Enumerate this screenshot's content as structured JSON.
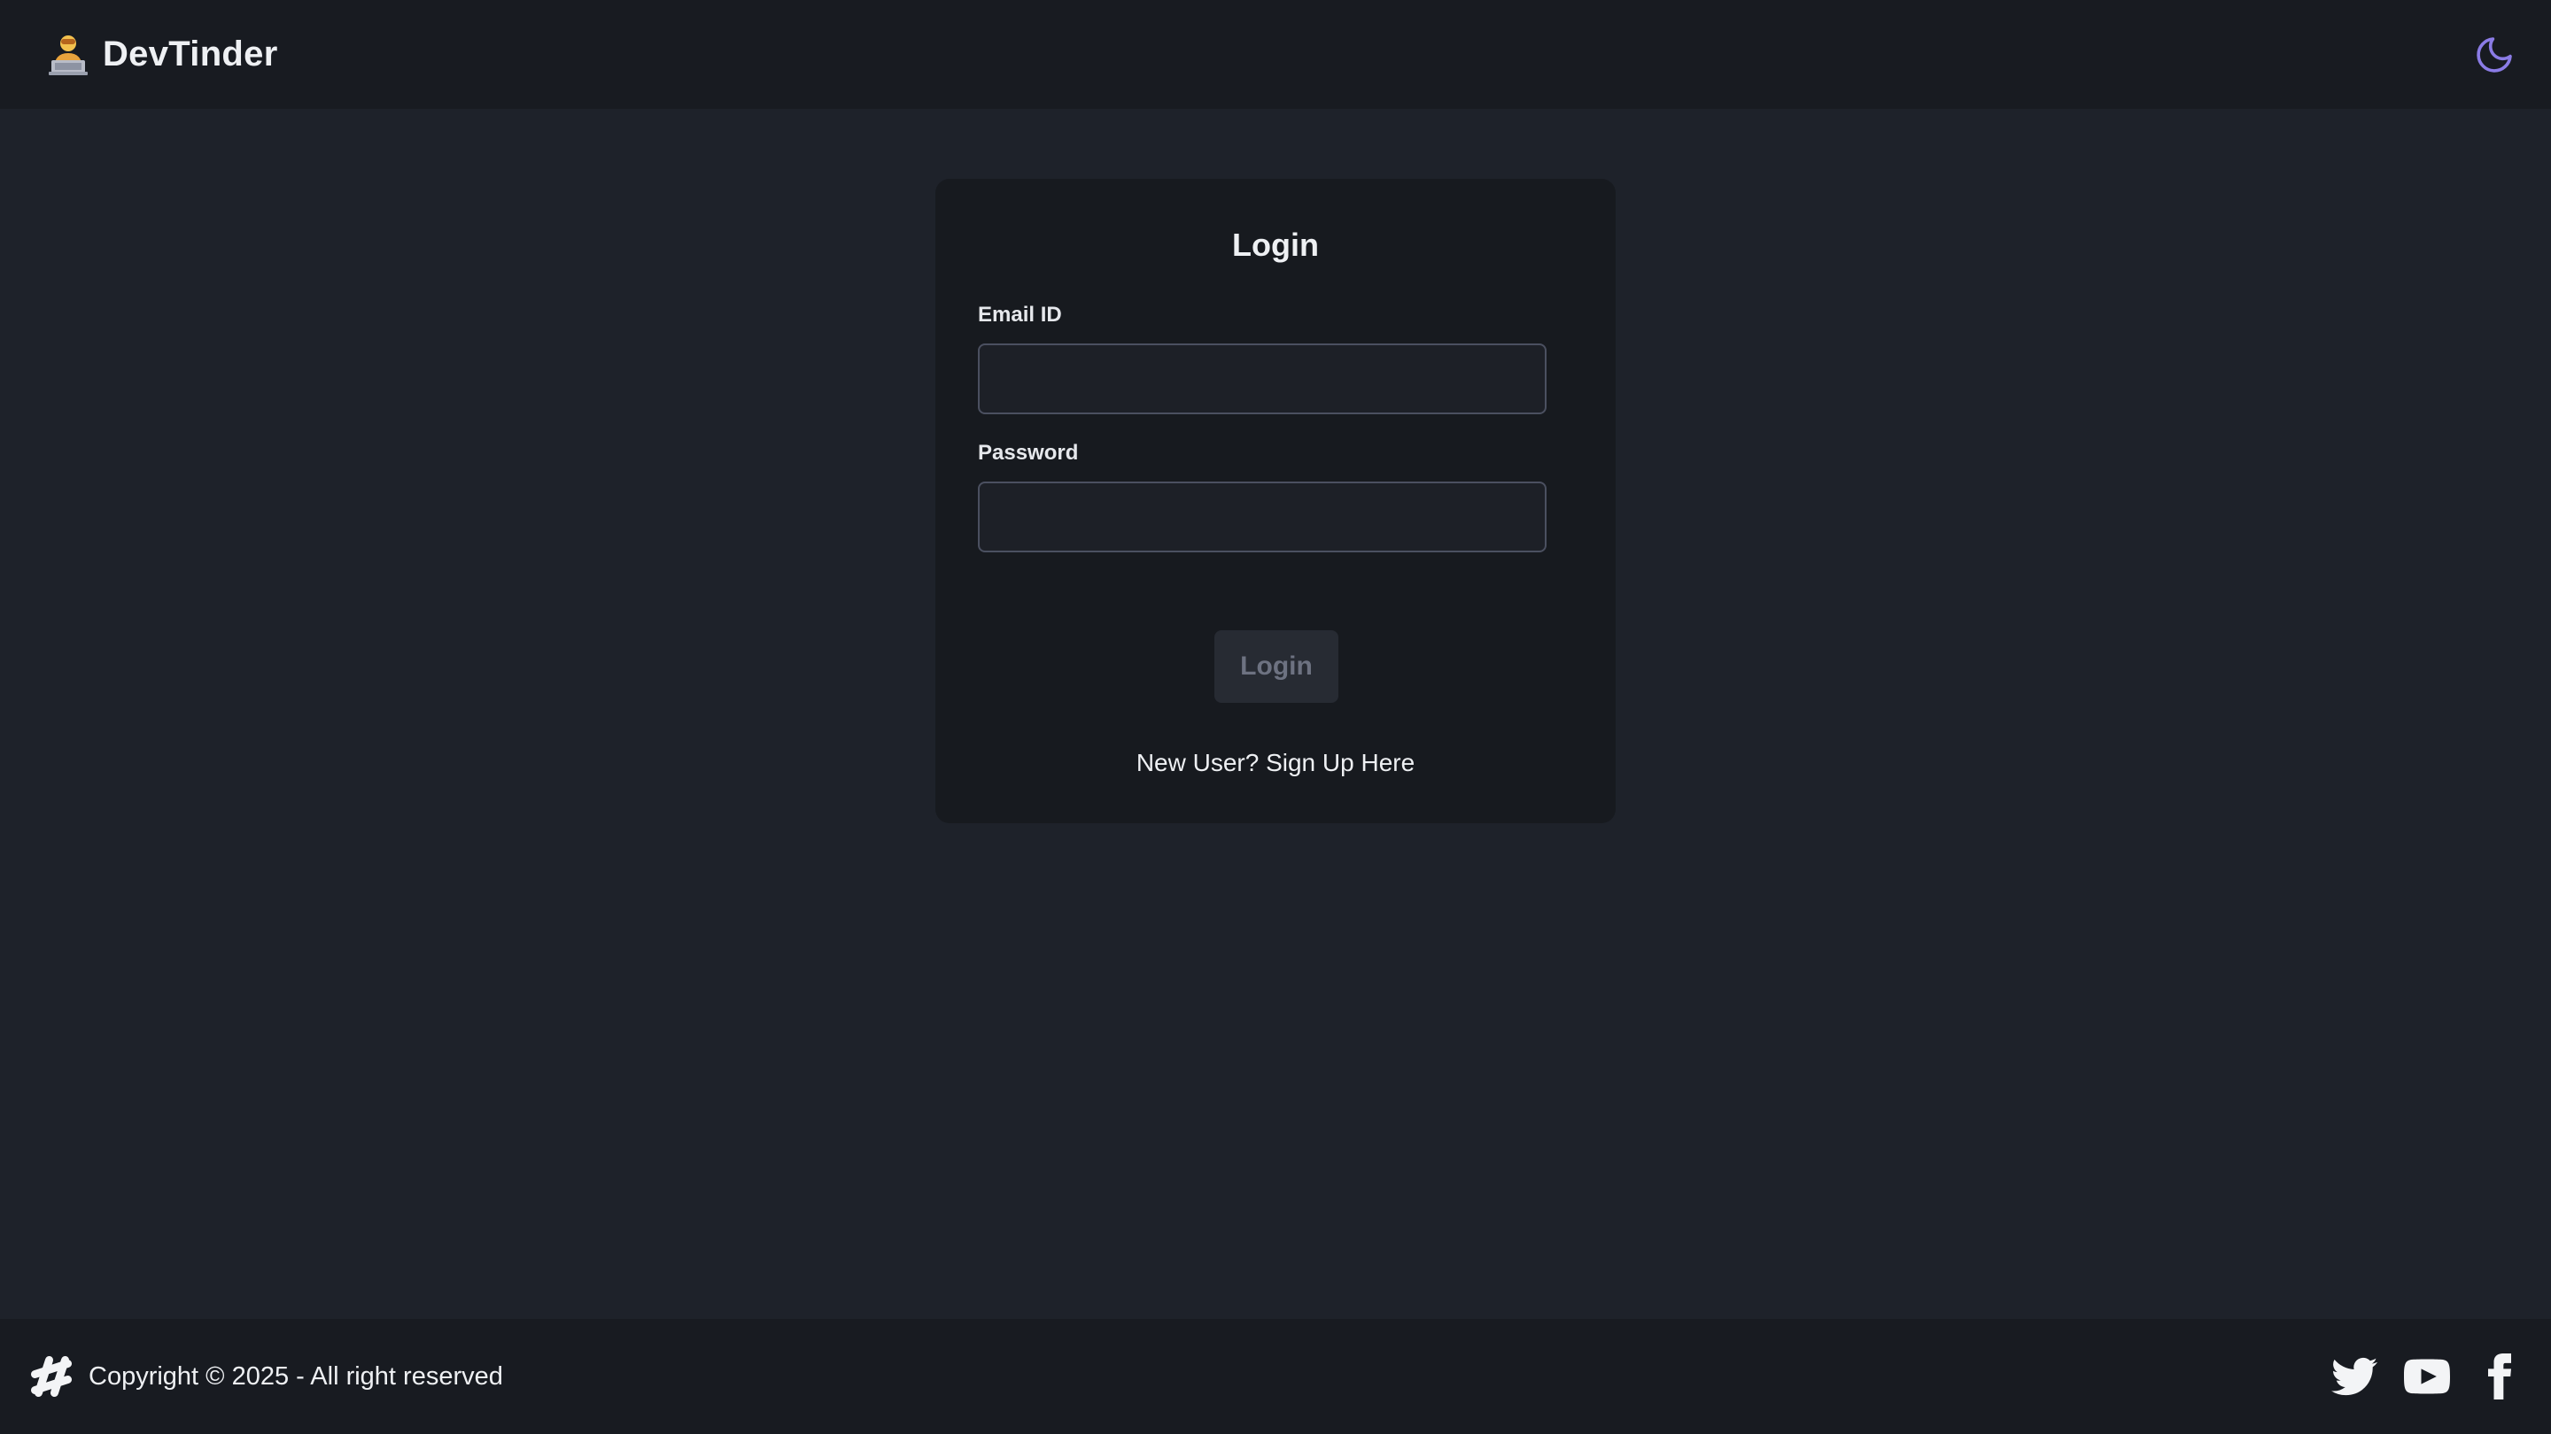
{
  "navbar": {
    "brand_name": "DevTinder",
    "brand_icon": "developer-avatar-icon",
    "theme_icon": "moon-icon",
    "accent_color": "#8b7ce6"
  },
  "login_card": {
    "title": "Login",
    "email_label": "Email ID",
    "email_value": "",
    "password_label": "Password",
    "password_value": "",
    "submit_label": "Login",
    "signup_link": "New User? Sign Up Here"
  },
  "footer": {
    "logo_icon": "hashtag-logo-icon",
    "copyright": "Copyright © 2025 - All right reserved",
    "social_icons": [
      "twitter-icon",
      "youtube-icon",
      "facebook-icon"
    ]
  },
  "colors": {
    "background": "#1e222a",
    "bar": "#181b21",
    "card": "#171a1f",
    "input_border": "#4b5060",
    "button_disabled": "#272b33"
  }
}
